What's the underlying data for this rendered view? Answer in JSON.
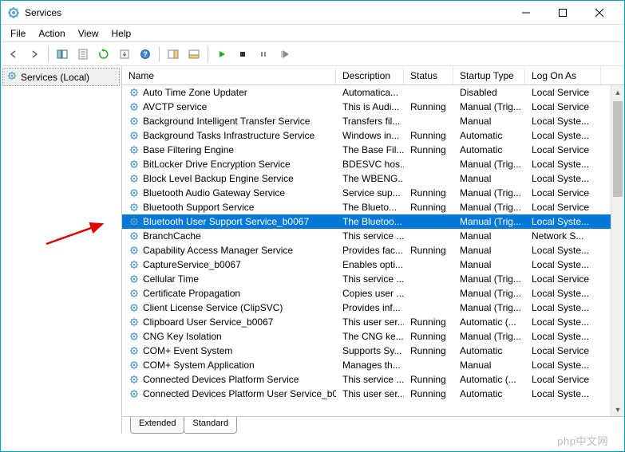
{
  "window": {
    "title": "Services"
  },
  "menu": {
    "file": "File",
    "action": "Action",
    "view": "View",
    "help": "Help"
  },
  "sidebar": {
    "root": "Services (Local)"
  },
  "columns": {
    "name": "Name",
    "description": "Description",
    "status": "Status",
    "startup": "Startup Type",
    "logon": "Log On As"
  },
  "tabs": {
    "extended": "Extended",
    "standard": "Standard"
  },
  "watermark": "php中文网",
  "services": [
    {
      "name": "Auto Time Zone Updater",
      "desc": "Automatica...",
      "status": "",
      "startup": "Disabled",
      "logon": "Local Service"
    },
    {
      "name": "AVCTP service",
      "desc": "This is Audi...",
      "status": "Running",
      "startup": "Manual (Trig...",
      "logon": "Local Service"
    },
    {
      "name": "Background Intelligent Transfer Service",
      "desc": "Transfers fil...",
      "status": "",
      "startup": "Manual",
      "logon": "Local Syste..."
    },
    {
      "name": "Background Tasks Infrastructure Service",
      "desc": "Windows in...",
      "status": "Running",
      "startup": "Automatic",
      "logon": "Local Syste..."
    },
    {
      "name": "Base Filtering Engine",
      "desc": "The Base Fil...",
      "status": "Running",
      "startup": "Automatic",
      "logon": "Local Service"
    },
    {
      "name": "BitLocker Drive Encryption Service",
      "desc": "BDESVC hos...",
      "status": "",
      "startup": "Manual (Trig...",
      "logon": "Local Syste..."
    },
    {
      "name": "Block Level Backup Engine Service",
      "desc": "The WBENG...",
      "status": "",
      "startup": "Manual",
      "logon": "Local Syste..."
    },
    {
      "name": "Bluetooth Audio Gateway Service",
      "desc": "Service sup...",
      "status": "Running",
      "startup": "Manual (Trig...",
      "logon": "Local Service"
    },
    {
      "name": "Bluetooth Support Service",
      "desc": "The Blueto...",
      "status": "Running",
      "startup": "Manual (Trig...",
      "logon": "Local Service"
    },
    {
      "name": "Bluetooth User Support Service_b0067",
      "desc": "The Bluetoo...",
      "status": "",
      "startup": "Manual (Trig...",
      "logon": "Local Syste...",
      "selected": true
    },
    {
      "name": "BranchCache",
      "desc": "This service ...",
      "status": "",
      "startup": "Manual",
      "logon": "Network S..."
    },
    {
      "name": "Capability Access Manager Service",
      "desc": "Provides fac...",
      "status": "Running",
      "startup": "Manual",
      "logon": "Local Syste..."
    },
    {
      "name": "CaptureService_b0067",
      "desc": "Enables opti...",
      "status": "",
      "startup": "Manual",
      "logon": "Local Syste..."
    },
    {
      "name": "Cellular Time",
      "desc": "This service ...",
      "status": "",
      "startup": "Manual (Trig...",
      "logon": "Local Service"
    },
    {
      "name": "Certificate Propagation",
      "desc": "Copies user ...",
      "status": "",
      "startup": "Manual (Trig...",
      "logon": "Local Syste..."
    },
    {
      "name": "Client License Service (ClipSVC)",
      "desc": "Provides inf...",
      "status": "",
      "startup": "Manual (Trig...",
      "logon": "Local Syste..."
    },
    {
      "name": "Clipboard User Service_b0067",
      "desc": "This user ser...",
      "status": "Running",
      "startup": "Automatic (...",
      "logon": "Local Syste..."
    },
    {
      "name": "CNG Key Isolation",
      "desc": "The CNG ke...",
      "status": "Running",
      "startup": "Manual (Trig...",
      "logon": "Local Syste..."
    },
    {
      "name": "COM+ Event System",
      "desc": "Supports Sy...",
      "status": "Running",
      "startup": "Automatic",
      "logon": "Local Service"
    },
    {
      "name": "COM+ System Application",
      "desc": "Manages th...",
      "status": "",
      "startup": "Manual",
      "logon": "Local Syste..."
    },
    {
      "name": "Connected Devices Platform Service",
      "desc": "This service ...",
      "status": "Running",
      "startup": "Automatic (...",
      "logon": "Local Service"
    },
    {
      "name": "Connected Devices Platform User Service_b0...",
      "desc": "This user ser...",
      "status": "Running",
      "startup": "Automatic",
      "logon": "Local Syste..."
    }
  ]
}
